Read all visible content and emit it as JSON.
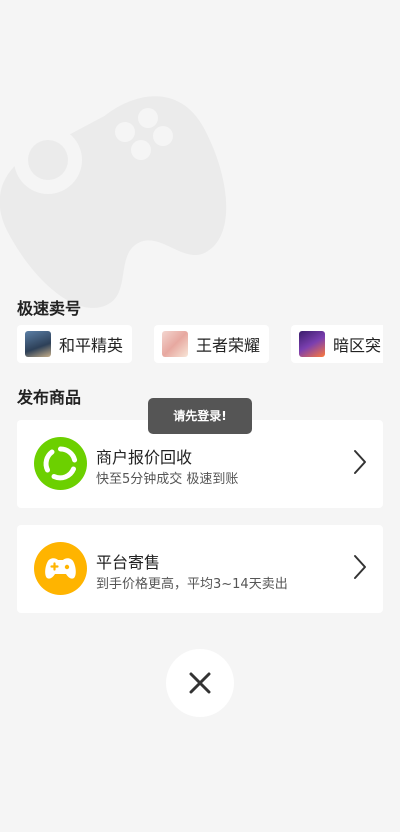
{
  "quick_sell": {
    "title": "极速卖号",
    "games": [
      {
        "label": "和平精英",
        "icon": "game-thumb-peace-elite"
      },
      {
        "label": "王者荣耀",
        "icon": "game-thumb-honor-of-kings"
      },
      {
        "label": "暗区突",
        "icon": "game-thumb-arena-breakout"
      }
    ]
  },
  "publish": {
    "title": "发布商品",
    "cards": [
      {
        "title": "商户报价回收",
        "subtitle": "快至5分钟成交 极速到账",
        "icon": "recycle-icon",
        "color": "#6cd000"
      },
      {
        "title": "平台寄售",
        "subtitle": "到手价格更高，平均3~14天卖出",
        "icon": "gamepad-icon",
        "color": "#ffb400"
      }
    ]
  },
  "toast": {
    "text": "请先登录!"
  },
  "close": {
    "icon": "close-icon"
  }
}
